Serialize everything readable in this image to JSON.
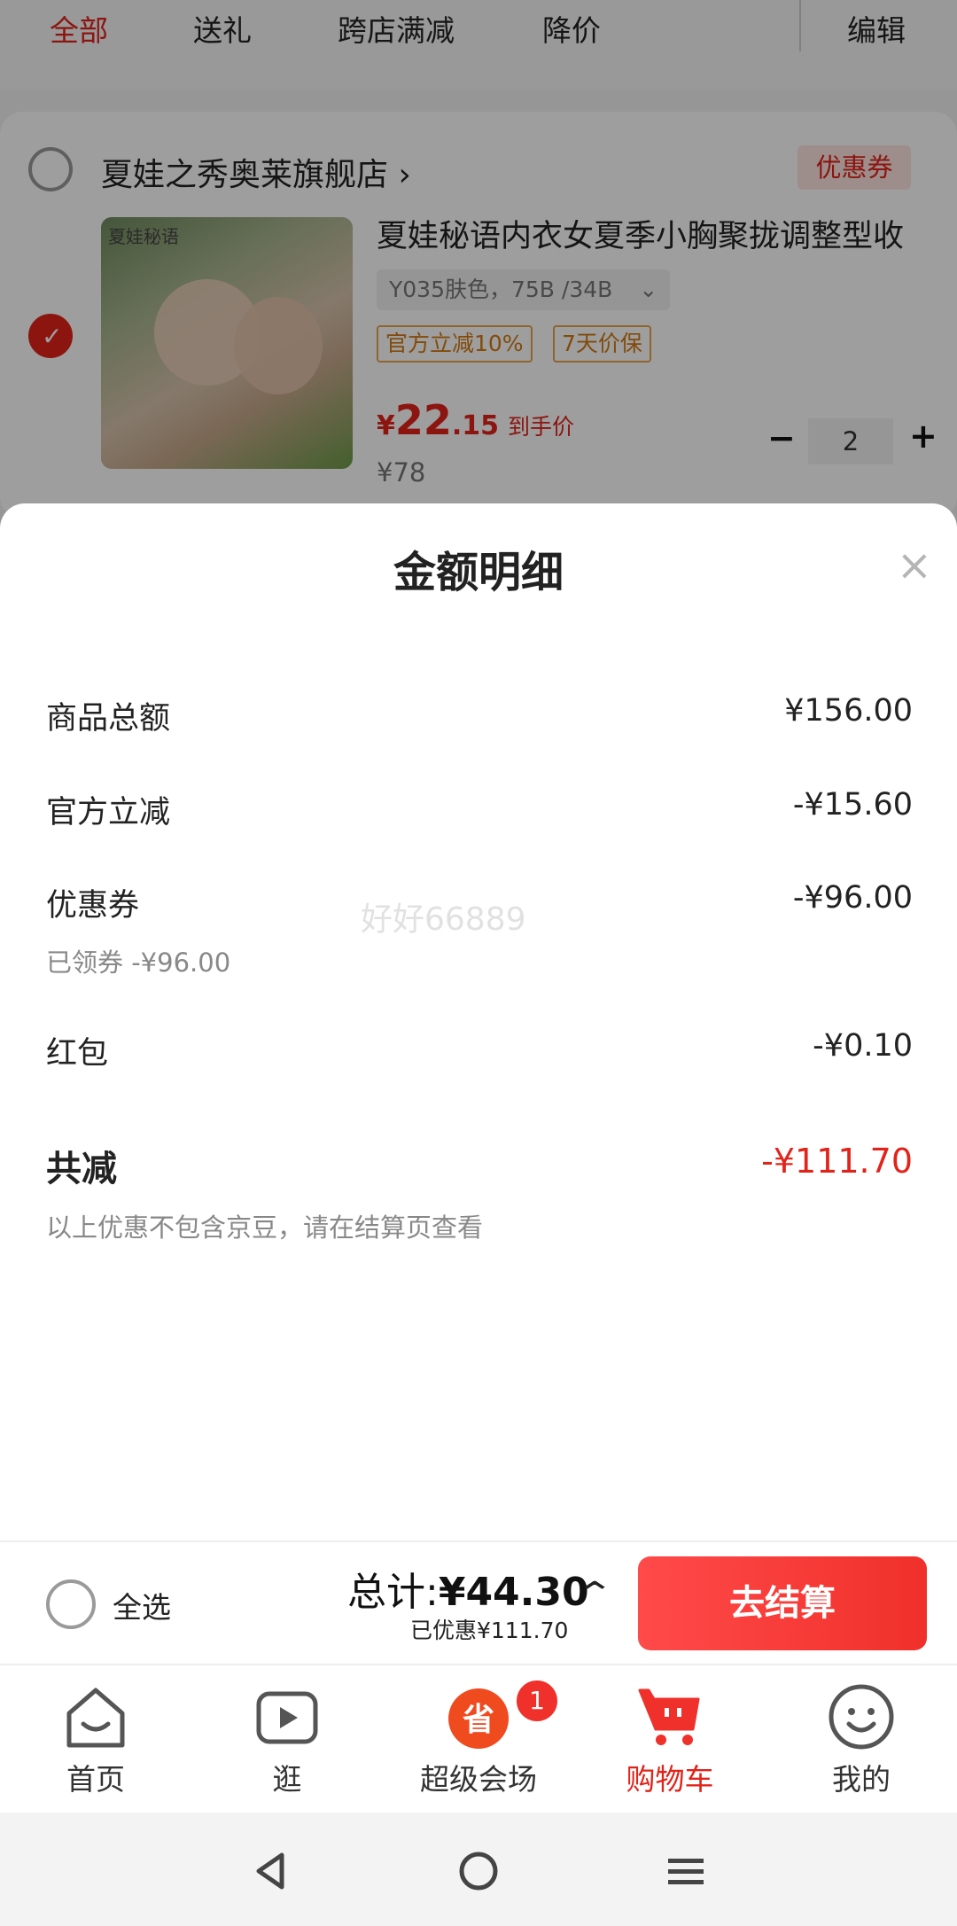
{
  "filter_tabs": [
    "全部",
    "送礼",
    "跨店满减",
    "降价"
  ],
  "edit_label": "编辑",
  "store": {
    "name": "夏娃之秀奥莱旗舰店",
    "chevron": "›",
    "coupon_label": "优惠券"
  },
  "product": {
    "image_brand_text": "夏娃秘语",
    "title": "夏娃秘语内衣女夏季小胸聚拢调整型收",
    "sku": "Y035肤色，75B /34B",
    "sku_chevron": "⌄",
    "tags": [
      "官方立减10%",
      "7天价保"
    ],
    "price_symbol": "¥",
    "price_int": "22",
    "price_dec": ".15",
    "price_note": "到手价",
    "original_price": "¥78",
    "quantity": "2",
    "minus": "−",
    "plus": "+"
  },
  "sheet": {
    "title": "金额明细",
    "close": "×",
    "rows": [
      {
        "label": "商品总额",
        "value": "¥156.00"
      },
      {
        "label": "官方立减",
        "value": "-¥15.60"
      },
      {
        "label": "优惠券",
        "value": "-¥96.00"
      },
      {
        "label": "红包",
        "value": "-¥0.10"
      }
    ],
    "coupon_claimed": "已领券 -¥96.00",
    "total_label": "共减",
    "total_value": "-¥111.70",
    "footnote": "以上优惠不包含京豆，请在结算页查看",
    "watermark": "好好66889"
  },
  "checkout": {
    "select_all": "全选",
    "total_prefix": "总计:",
    "total_amount": "¥44.30",
    "saved": "已优惠¥111.70",
    "expand": "⌃",
    "button": "去结算"
  },
  "tabbar": [
    {
      "label": "首页",
      "icon": "home-icon"
    },
    {
      "label": "逛",
      "icon": "play-video-icon"
    },
    {
      "label": "超级会场",
      "icon": "super-venue-icon",
      "badge": "1",
      "badge_glyph": "省"
    },
    {
      "label": "购物车",
      "icon": "cart-icon",
      "active": true
    },
    {
      "label": "我的",
      "icon": "smiley-profile-icon"
    }
  ],
  "system_nav": [
    "back-icon",
    "home-circle-icon",
    "menu-icon"
  ],
  "colors": {
    "accent": "#e2231a",
    "tag_orange": "#d27a12",
    "muted": "#888888"
  }
}
